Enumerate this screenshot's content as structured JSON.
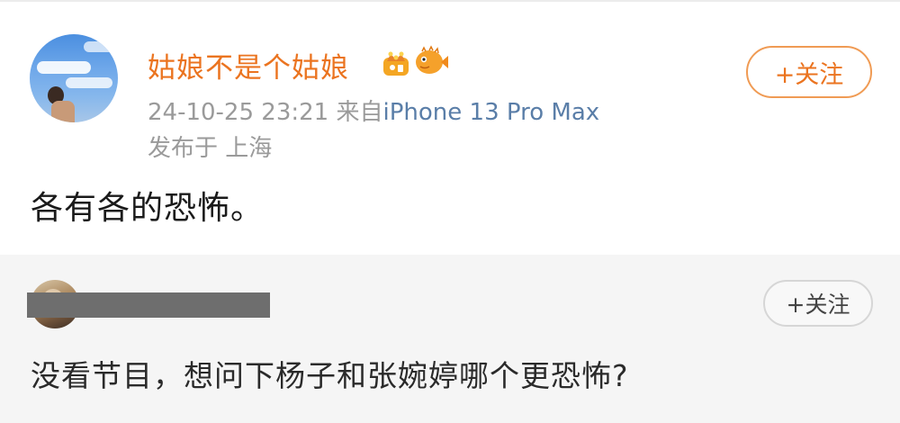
{
  "post": {
    "username": "姑娘不是个姑娘",
    "badges": [
      "crown-badge-icon",
      "pufferfish-badge-icon"
    ],
    "timestamp": "24-10-25 23:21",
    "source_prefix": "来自",
    "device": "iPhone 13 Pro Max",
    "location": "发布于 上海",
    "follow_label": "+关注",
    "content": "各有各的恐怖。"
  },
  "comment": {
    "follow_label": "+关注",
    "content": "没看节目，想问下杨子和张婉婷哪个更恐怖?"
  },
  "colors": {
    "username": "#eb7420",
    "device_link": "#5a7ea8",
    "meta_text": "#9a9a9a",
    "follow_border": "#f09b54",
    "comment_bg": "#f5f5f5",
    "redaction": "#6e6e6e"
  }
}
